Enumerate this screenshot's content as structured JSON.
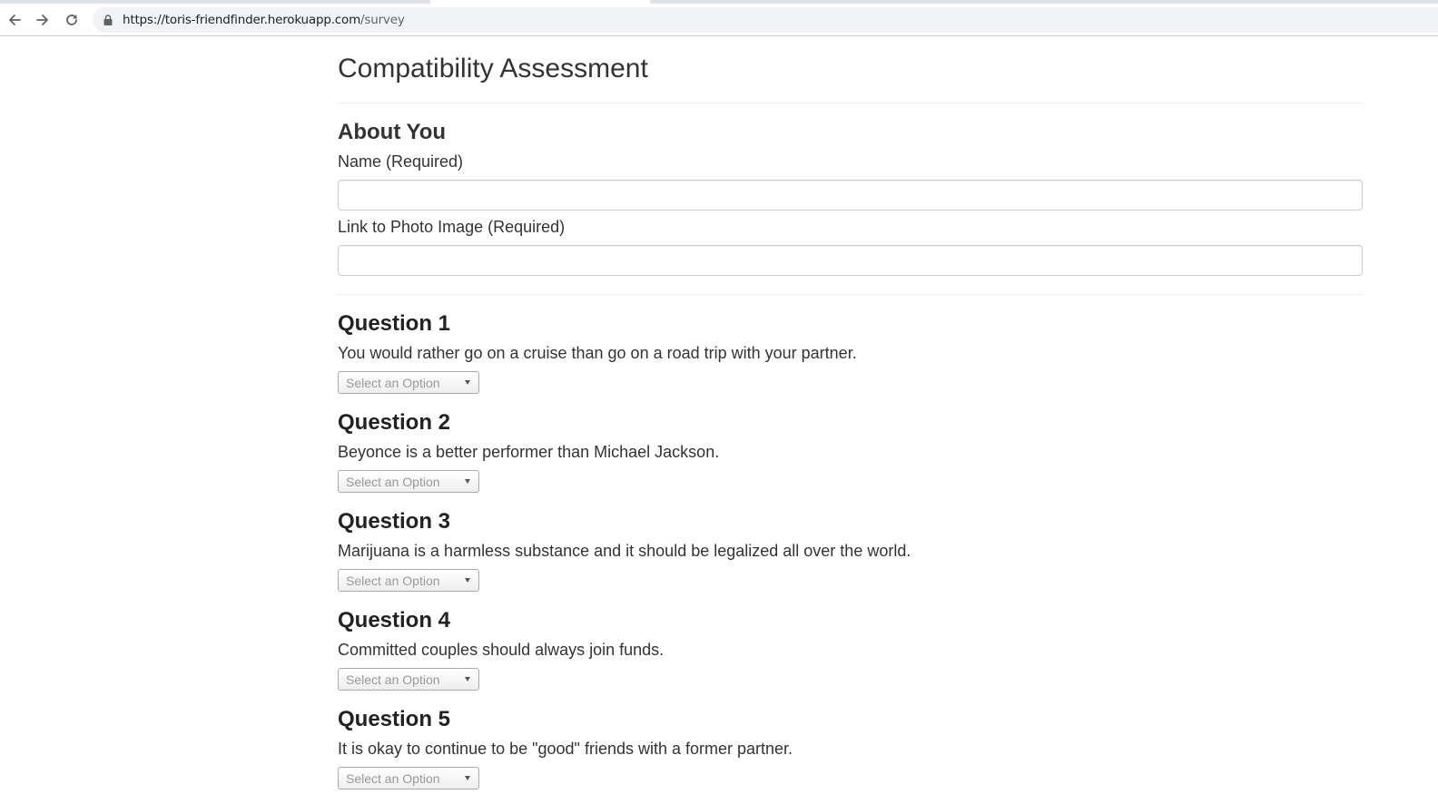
{
  "browser": {
    "url_host": "https://toris-friendfinder.herokuapp.com",
    "url_path": "/survey"
  },
  "page": {
    "title": "Compatibility Assessment"
  },
  "about": {
    "heading": "About You",
    "name_label": "Name (Required)",
    "name_value": "",
    "photo_label": "Link to Photo Image (Required)",
    "photo_value": ""
  },
  "questions": [
    {
      "title": "Question 1",
      "text": "You would rather go on a cruise than go on a road trip with your partner.",
      "select": "Select an Option"
    },
    {
      "title": "Question 2",
      "text": "Beyonce is a better performer than Michael Jackson.",
      "select": "Select an Option"
    },
    {
      "title": "Question 3",
      "text": "Marijuana is a harmless substance and it should be legalized all over the world.",
      "select": "Select an Option"
    },
    {
      "title": "Question 4",
      "text": "Committed couples should always join funds.",
      "select": "Select an Option"
    },
    {
      "title": "Question 5",
      "text": "It is okay to continue to be \"good\" friends with a former partner.",
      "select": "Select an Option"
    }
  ]
}
